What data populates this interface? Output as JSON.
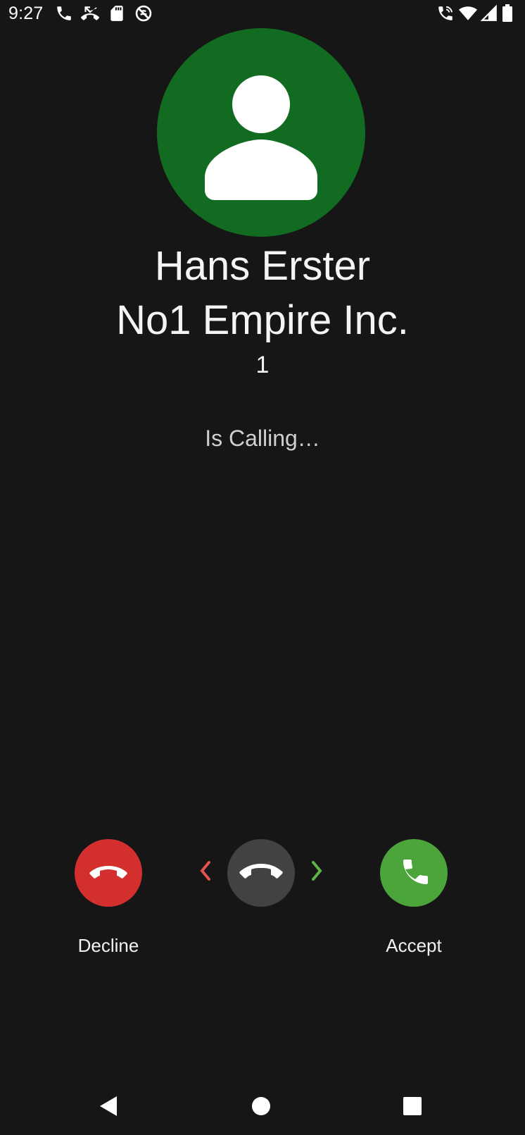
{
  "status_bar": {
    "time": "9:27",
    "left_icons": [
      "phone-icon",
      "missed-call-icon",
      "sd-card-icon",
      "do-not-disturb-icon"
    ],
    "right_icons": [
      "wifi-calling-icon",
      "wifi-icon",
      "cell-signal-icon",
      "battery-icon"
    ]
  },
  "caller": {
    "name": "Hans Erster",
    "company": "No1 Empire Inc.",
    "number": "1",
    "status": "Is Calling…",
    "avatar_icon": "person-icon",
    "avatar_color": "#116b20"
  },
  "actions": {
    "decline_label": "Decline",
    "accept_label": "Accept",
    "decline_color": "#d32f2f",
    "accept_color": "#4ba53a",
    "handle_color": "#424242"
  },
  "nav_bar": {
    "icons": [
      "back-icon",
      "home-icon",
      "recents-icon"
    ]
  }
}
